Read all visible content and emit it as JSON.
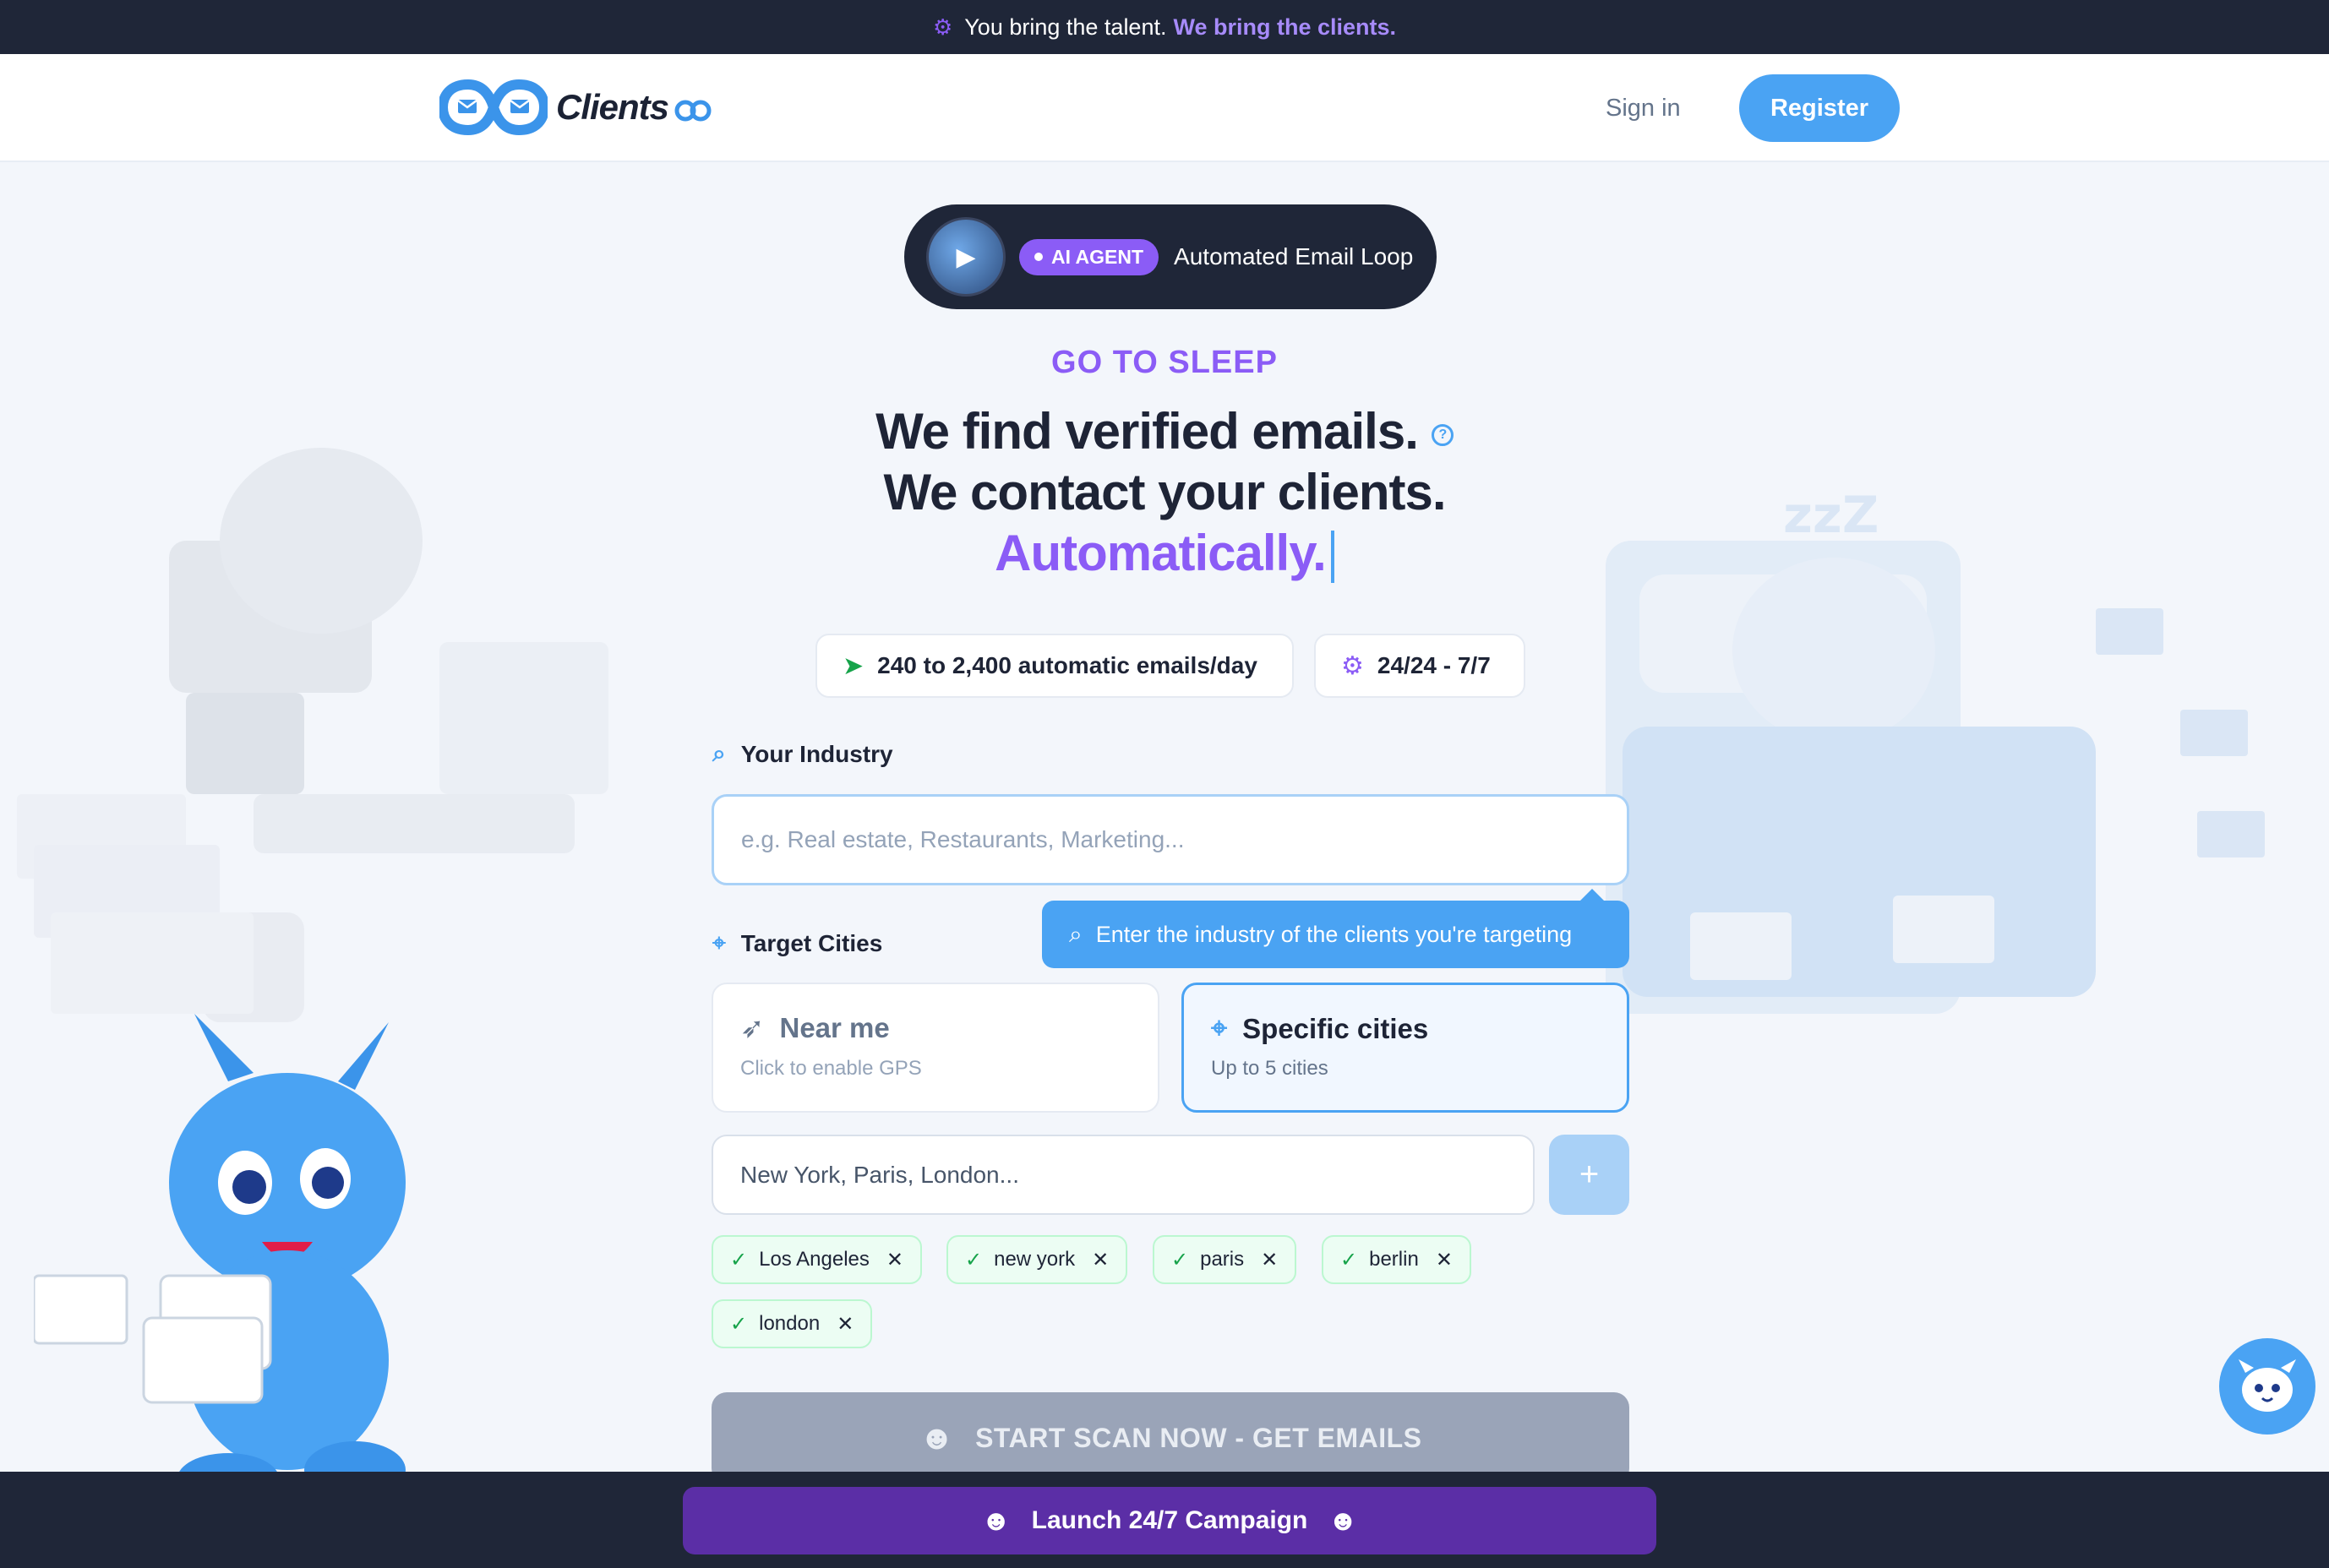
{
  "topbar": {
    "text": "You bring the talent.",
    "accent": "We bring the clients.",
    "icon": "gear-icon"
  },
  "nav": {
    "brand": "Clients",
    "signin": "Sign in",
    "register": "Register"
  },
  "hero": {
    "agent_badge": "AI AGENT",
    "agent_text": "Automated Email Loop",
    "eyebrow": "GO TO SLEEP",
    "line1": "We find verified emails.",
    "line2": "We contact your clients.",
    "line3": "Automatically."
  },
  "stats": [
    {
      "text": "240 to 2,400 automatic emails/day",
      "icon": "send-icon"
    },
    {
      "text": "24/24 - 7/7",
      "icon": "gear-icon"
    }
  ],
  "industry": {
    "label": "Your Industry",
    "placeholder": "e.g. Real estate, Restaurants, Marketing...",
    "value": "",
    "tooltip": "Enter the industry of the clients you're targeting"
  },
  "cities": {
    "label": "Target Cities",
    "near": {
      "title": "Near me",
      "sub": "Click to enable GPS"
    },
    "specific": {
      "title": "Specific cities",
      "sub": "Up to 5 cities"
    },
    "placeholder": "New York, Paris, London...",
    "add": "+",
    "chips": [
      "Los Angeles",
      "new york",
      "paris",
      "berlin",
      "london"
    ]
  },
  "actions": {
    "scan": "START SCAN NOW - GET EMAILS",
    "launch": "Launch 24/7 Campaign"
  },
  "colors": {
    "accent": "#4aa3f3",
    "purple": "#8b5cf6",
    "dark": "#1f2638",
    "success": "#16a34a"
  }
}
